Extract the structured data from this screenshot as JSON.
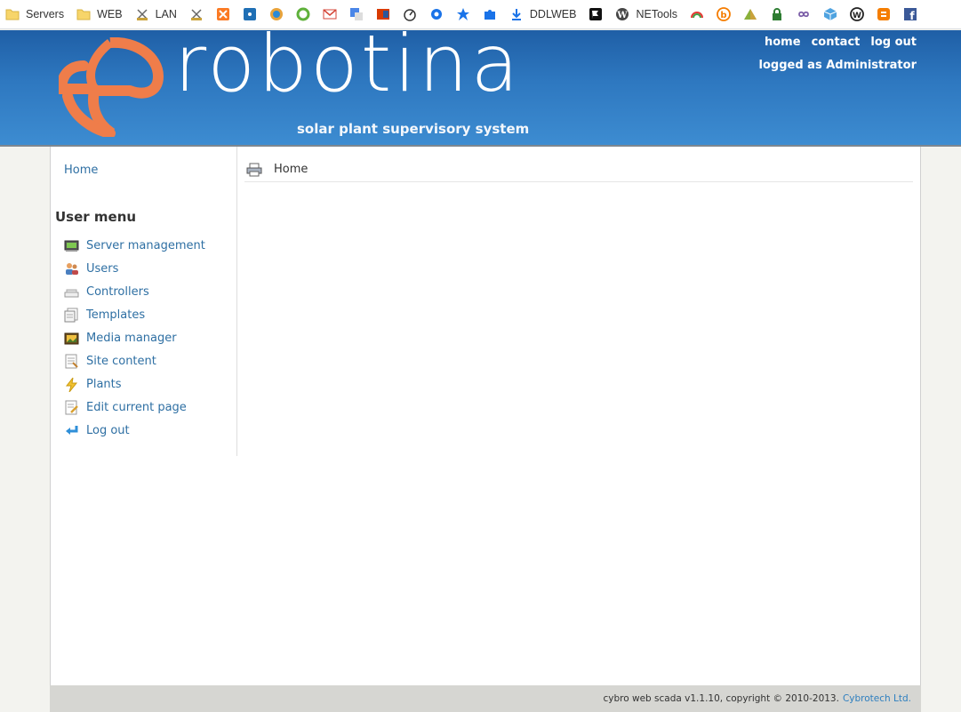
{
  "bookmarks": [
    {
      "icon": "folder-icon",
      "label": "Servers"
    },
    {
      "icon": "folder-icon",
      "label": "WEB"
    },
    {
      "icon": "network-icon",
      "label": "LAN"
    },
    {
      "icon": "network-icon",
      "label": ""
    },
    {
      "icon": "xampp-icon",
      "label": ""
    },
    {
      "icon": "radio-tower-icon",
      "label": ""
    },
    {
      "icon": "circle-logo-icon",
      "label": ""
    },
    {
      "icon": "refresh-leaf-icon",
      "label": ""
    },
    {
      "icon": "gmail-icon",
      "label": ""
    },
    {
      "icon": "translate-icon",
      "label": ""
    },
    {
      "icon": "office-icon",
      "label": ""
    },
    {
      "icon": "speedometer-icon",
      "label": ""
    },
    {
      "icon": "gear-icon",
      "label": ""
    },
    {
      "icon": "star-icon",
      "label": ""
    },
    {
      "icon": "puzzle-icon",
      "label": ""
    },
    {
      "icon": "download-icon",
      "label": "DDLWEB"
    },
    {
      "icon": "flag-icon",
      "label": ""
    },
    {
      "icon": "wordpress-icon",
      "label": "NETools"
    },
    {
      "icon": "rainbow-icon",
      "label": ""
    },
    {
      "icon": "b-circle-icon",
      "label": ""
    },
    {
      "icon": "pyramid-icon",
      "label": ""
    },
    {
      "icon": "lock-icon",
      "label": ""
    },
    {
      "icon": "infinity-icon",
      "label": ""
    },
    {
      "icon": "cube-icon",
      "label": ""
    },
    {
      "icon": "w-circle-icon",
      "label": ""
    },
    {
      "icon": "blogger-icon",
      "label": ""
    },
    {
      "icon": "facebook-icon",
      "label": ""
    }
  ],
  "header": {
    "logo_text": "robotina",
    "tagline": "solar plant supervisory system",
    "links": [
      "home",
      "contact",
      "log out"
    ],
    "logged_as": "logged as Administrator",
    "accent_color": "#ef7d4a"
  },
  "sidebar": {
    "home_link": "Home",
    "menu_title": "User menu",
    "items": [
      {
        "icon": "server-icon",
        "label": "Server management"
      },
      {
        "icon": "users-icon",
        "label": "Users"
      },
      {
        "icon": "controller-icon",
        "label": "Controllers"
      },
      {
        "icon": "templates-icon",
        "label": "Templates"
      },
      {
        "icon": "media-icon",
        "label": "Media manager"
      },
      {
        "icon": "site-content-icon",
        "label": "Site content"
      },
      {
        "icon": "lightning-icon",
        "label": "Plants"
      },
      {
        "icon": "edit-page-icon",
        "label": "Edit current page"
      },
      {
        "icon": "logout-arrow-icon",
        "label": "Log out"
      }
    ]
  },
  "content": {
    "breadcrumb": "Home"
  },
  "footer": {
    "text": "cybro web scada v1.1.10, copyright © 2010-2013.",
    "link": "Cybrotech Ltd."
  }
}
